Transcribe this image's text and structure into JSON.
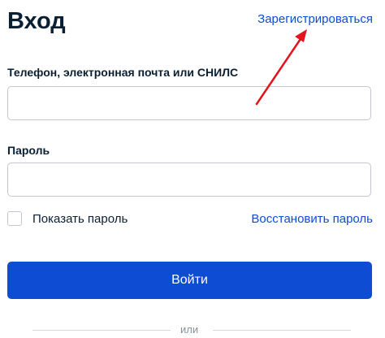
{
  "header": {
    "title": "Вход",
    "register_link": "Зарегистрироваться"
  },
  "form": {
    "login_label": "Телефон, электронная почта или СНИЛС",
    "login_value": "",
    "password_label": "Пароль",
    "password_value": "",
    "show_password_label": "Показать пароль",
    "show_password_checked": false,
    "restore_link": "Восстановить пароль",
    "submit_label": "Войти"
  },
  "footer": {
    "or_text": "или"
  },
  "annotation": {
    "arrow_color": "#e3141b",
    "arrow_points_to": "register_link"
  },
  "colors": {
    "accent": "#0d4cd3",
    "text": "#0b1f33",
    "border": "#c2c7cf"
  }
}
